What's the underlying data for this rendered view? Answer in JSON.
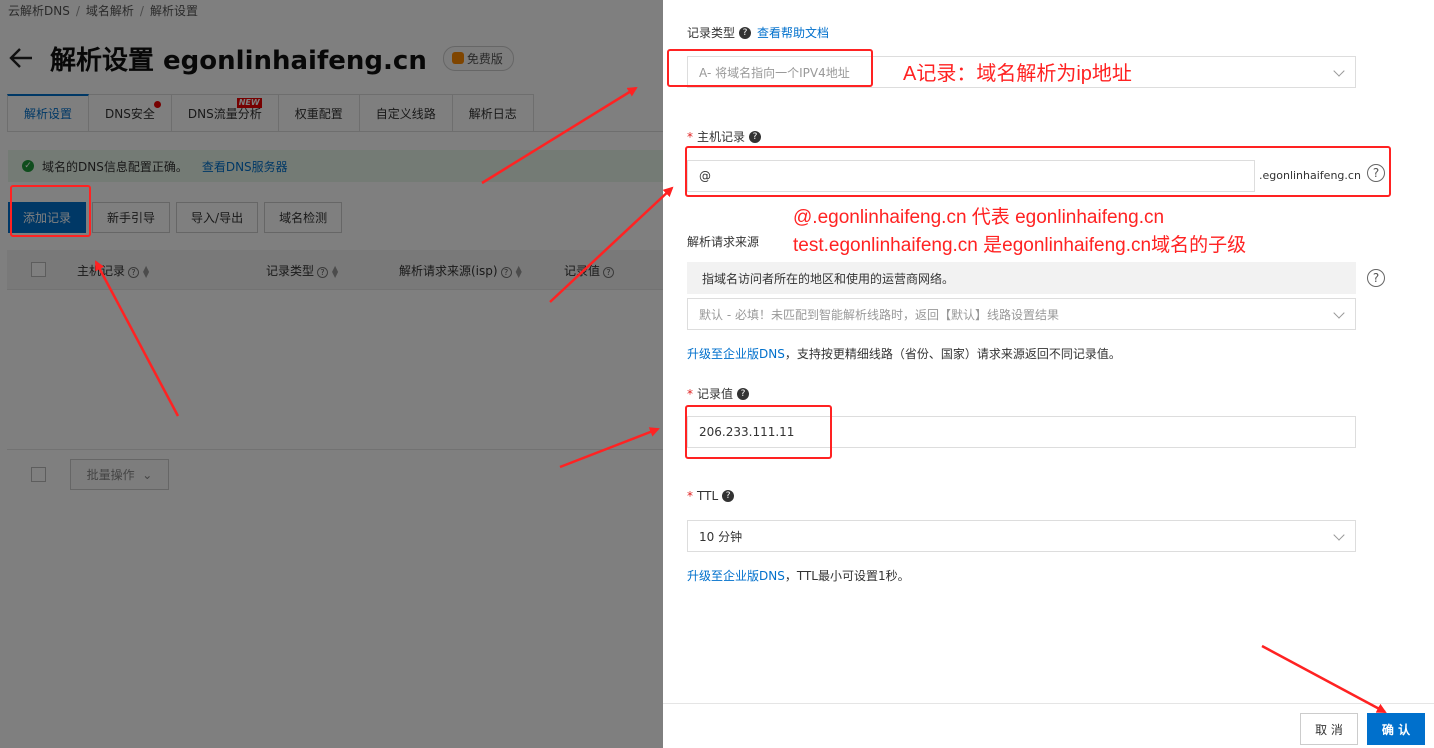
{
  "breadcrumb": [
    "云解析DNS",
    "域名解析",
    "解析设置"
  ],
  "page": {
    "title": "解析设置 egonlinhaifeng.cn",
    "badge": "免费版"
  },
  "tabs": [
    "解析设置",
    "DNS安全",
    "DNS流量分析",
    "权重配置",
    "自定义线路",
    "解析日志"
  ],
  "tab_badge": "NEW",
  "alert": {
    "text": "域名的DNS信息配置正确。",
    "link": "查看DNS服务器"
  },
  "actions": [
    "添加记录",
    "新手引导",
    "导入/导出",
    "域名检测"
  ],
  "table": {
    "headers": [
      "主机记录",
      "记录类型",
      "解析请求来源(isp)",
      "记录值"
    ]
  },
  "bulk": {
    "label": "批量操作"
  },
  "drawer": {
    "record_type": {
      "label": "记录类型",
      "help_link": "查看帮助文档",
      "placeholder": "A- 将域名指向一个IPV4地址"
    },
    "host": {
      "label": "主机记录",
      "value": "@",
      "suffix": ".egonlinhaifeng.cn"
    },
    "isp": {
      "label": "解析请求来源",
      "note": "指域名访问者所在的地区和使用的运营商网络。",
      "placeholder": "默认 - 必填！未匹配到智能解析线路时，返回【默认】线路设置结果",
      "hint_link": "升级至企业版DNS",
      "hint_text": "，支持按更精细线路（省份、国家）请求来源返回不同记录值。"
    },
    "value": {
      "label": "记录值",
      "value": "206.233.111.11"
    },
    "ttl": {
      "label": "TTL",
      "value": "10 分钟",
      "hint_link": "升级至企业版DNS",
      "hint_text": "，TTL最小可设置1秒。"
    },
    "cancel": "取 消",
    "confirm": "确 认"
  },
  "annotations": {
    "a_record": "A记录：域名解析为ip地址",
    "line1": "@.egonlinhaifeng.cn 代表 egonlinhaifeng.cn",
    "line2": "test.egonlinhaifeng.cn 是egonlinhaifeng.cn域名的子级"
  },
  "colors": {
    "primary": "#0070cc",
    "annotation": "#ff2222",
    "success": "#1f9a3a"
  }
}
